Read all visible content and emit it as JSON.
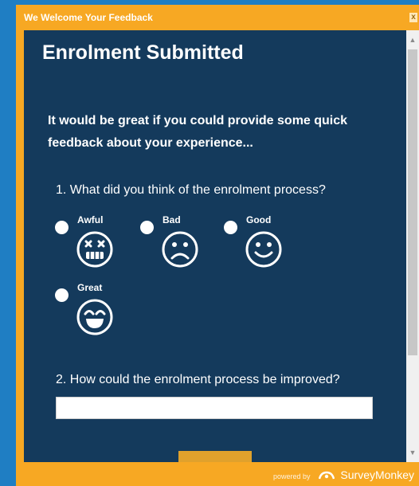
{
  "window": {
    "title": "We Welcome Your Feedback",
    "close_label": "x"
  },
  "survey": {
    "heading": "Enrolment Submitted",
    "intro": "It would be great if you could provide some quick feedback about your experience...",
    "question1": {
      "text": "1. What did you think of the enrolment process?",
      "options": [
        {
          "label": "Awful",
          "icon": "dizzy-face-icon"
        },
        {
          "label": "Bad",
          "icon": "sad-face-icon"
        },
        {
          "label": "Good",
          "icon": "smiley-face-icon"
        },
        {
          "label": "Great",
          "icon": "laughing-face-icon"
        }
      ]
    },
    "question2": {
      "text": "2. How could the enrolment process be improved?",
      "value": ""
    }
  },
  "footer": {
    "powered_by": "powered by",
    "brand": "SurveyMonkey"
  },
  "colors": {
    "frame": "#f7a823",
    "panel": "#143a5c",
    "background": "#1f7ec3"
  }
}
